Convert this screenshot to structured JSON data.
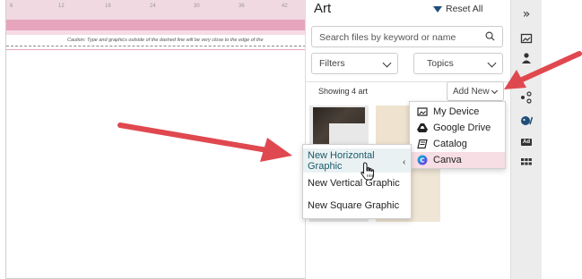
{
  "ruler": {
    "ticks": [
      "6",
      "12",
      "18",
      "24",
      "30",
      "36",
      "42"
    ]
  },
  "canvas": {
    "caution_text": "Caution: Type and graphics outside of the dashed line will be very close to the edge of the"
  },
  "panel": {
    "title": "Art",
    "reset_label": "Reset All",
    "search": {
      "placeholder": "Search files by keyword or name",
      "value": ""
    },
    "filters_label": "Filters",
    "topics_label": "Topics",
    "showing_label": "Showing 4 art",
    "add_new_label": "Add New"
  },
  "add_menu": {
    "items": [
      {
        "label": "My Device",
        "icon": "device-icon"
      },
      {
        "label": "Google Drive",
        "icon": "google-drive-icon"
      },
      {
        "label": "Catalog",
        "icon": "catalog-icon"
      },
      {
        "label": "Canva",
        "icon": "canva-icon"
      }
    ],
    "active": "Canva"
  },
  "new_menu": {
    "items": [
      {
        "label": "New Horizontal Graphic"
      },
      {
        "label": "New Vertical Graphic"
      },
      {
        "label": "New Square Graphic"
      }
    ],
    "highlighted": "New Horizontal Graphic"
  },
  "rail": {
    "icons": [
      "collapse-icon",
      "image-icon",
      "person-icon",
      "share-icon",
      "art-palette-icon",
      "ad-icon",
      "grid-icon"
    ],
    "ad_label": "Ad"
  },
  "colors": {
    "annotation_arrow": "#e0484f",
    "brand_accent": "#1f4e79",
    "pink_band": "#e6a5bd",
    "active_menu": "#f7dde4",
    "canva": "#7d2ae8"
  }
}
